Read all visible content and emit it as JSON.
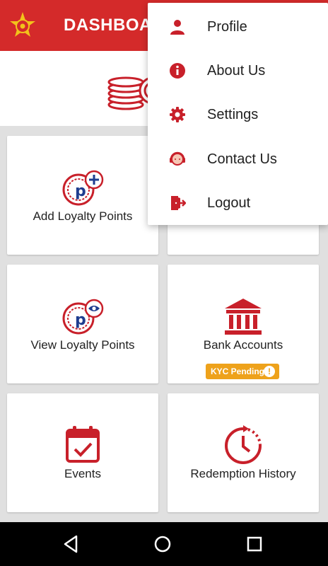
{
  "appbar": {
    "title": "DASHBOARD"
  },
  "cards": [
    {
      "label": "Add Loyalty Points",
      "icon": "add-points-icon"
    },
    {
      "label": "",
      "icon": ""
    },
    {
      "label": "View Loyalty Points",
      "icon": "view-points-icon"
    },
    {
      "label": "Bank Accounts",
      "icon": "bank-icon",
      "badge": "KYC Pending"
    },
    {
      "label": "Events",
      "icon": "calendar-icon"
    },
    {
      "label": "Redemption History",
      "icon": "history-icon"
    }
  ],
  "menu": {
    "items": [
      {
        "label": "Profile",
        "icon": "person-icon"
      },
      {
        "label": "About Us",
        "icon": "info-icon"
      },
      {
        "label": "Settings",
        "icon": "gear-icon"
      },
      {
        "label": "Contact Us",
        "icon": "support-agent-icon"
      },
      {
        "label": "Logout",
        "icon": "logout-icon"
      }
    ]
  },
  "colors": {
    "primary": "#d42a2a",
    "badge": "#eea21b",
    "accent_blue": "#1e3d8f"
  }
}
